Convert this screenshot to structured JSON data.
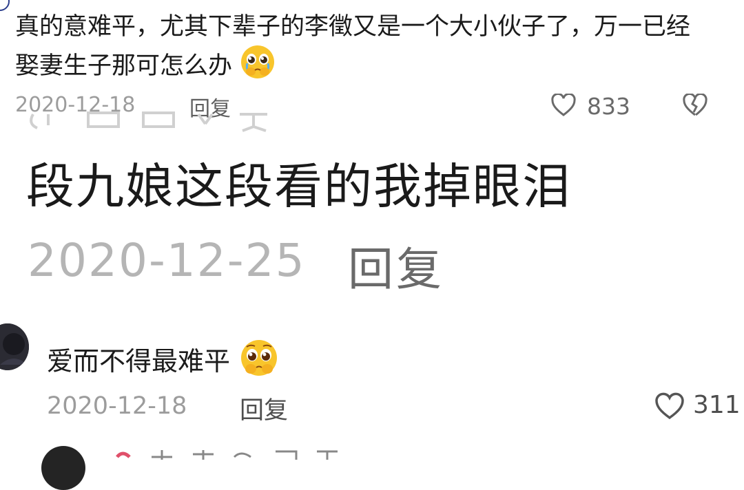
{
  "comment1": {
    "text": "真的意难平，尤其下辈子的李徵又是一个大小伙子了，万一已经娶妻生子那可怎么办",
    "emoji_icon": "crying-pleading-face-icon",
    "date": "2020-12-18",
    "reply_label": "回复",
    "likes": "833"
  },
  "overlay": {
    "text": "段九娘这段看的我掉眼泪",
    "date": "2020-12-25",
    "reply_label": "回复"
  },
  "comment2": {
    "text": "爱而不得最难平",
    "emoji_icon": "pleading-face-icon",
    "date": "2020-12-18",
    "reply_label": "回复",
    "likes": "311"
  },
  "colors": {
    "text": "#1b1b1b",
    "meta": "#9c9c9c",
    "reply": "#5f5f5f",
    "emoji_yellow": "#f8c52c"
  }
}
